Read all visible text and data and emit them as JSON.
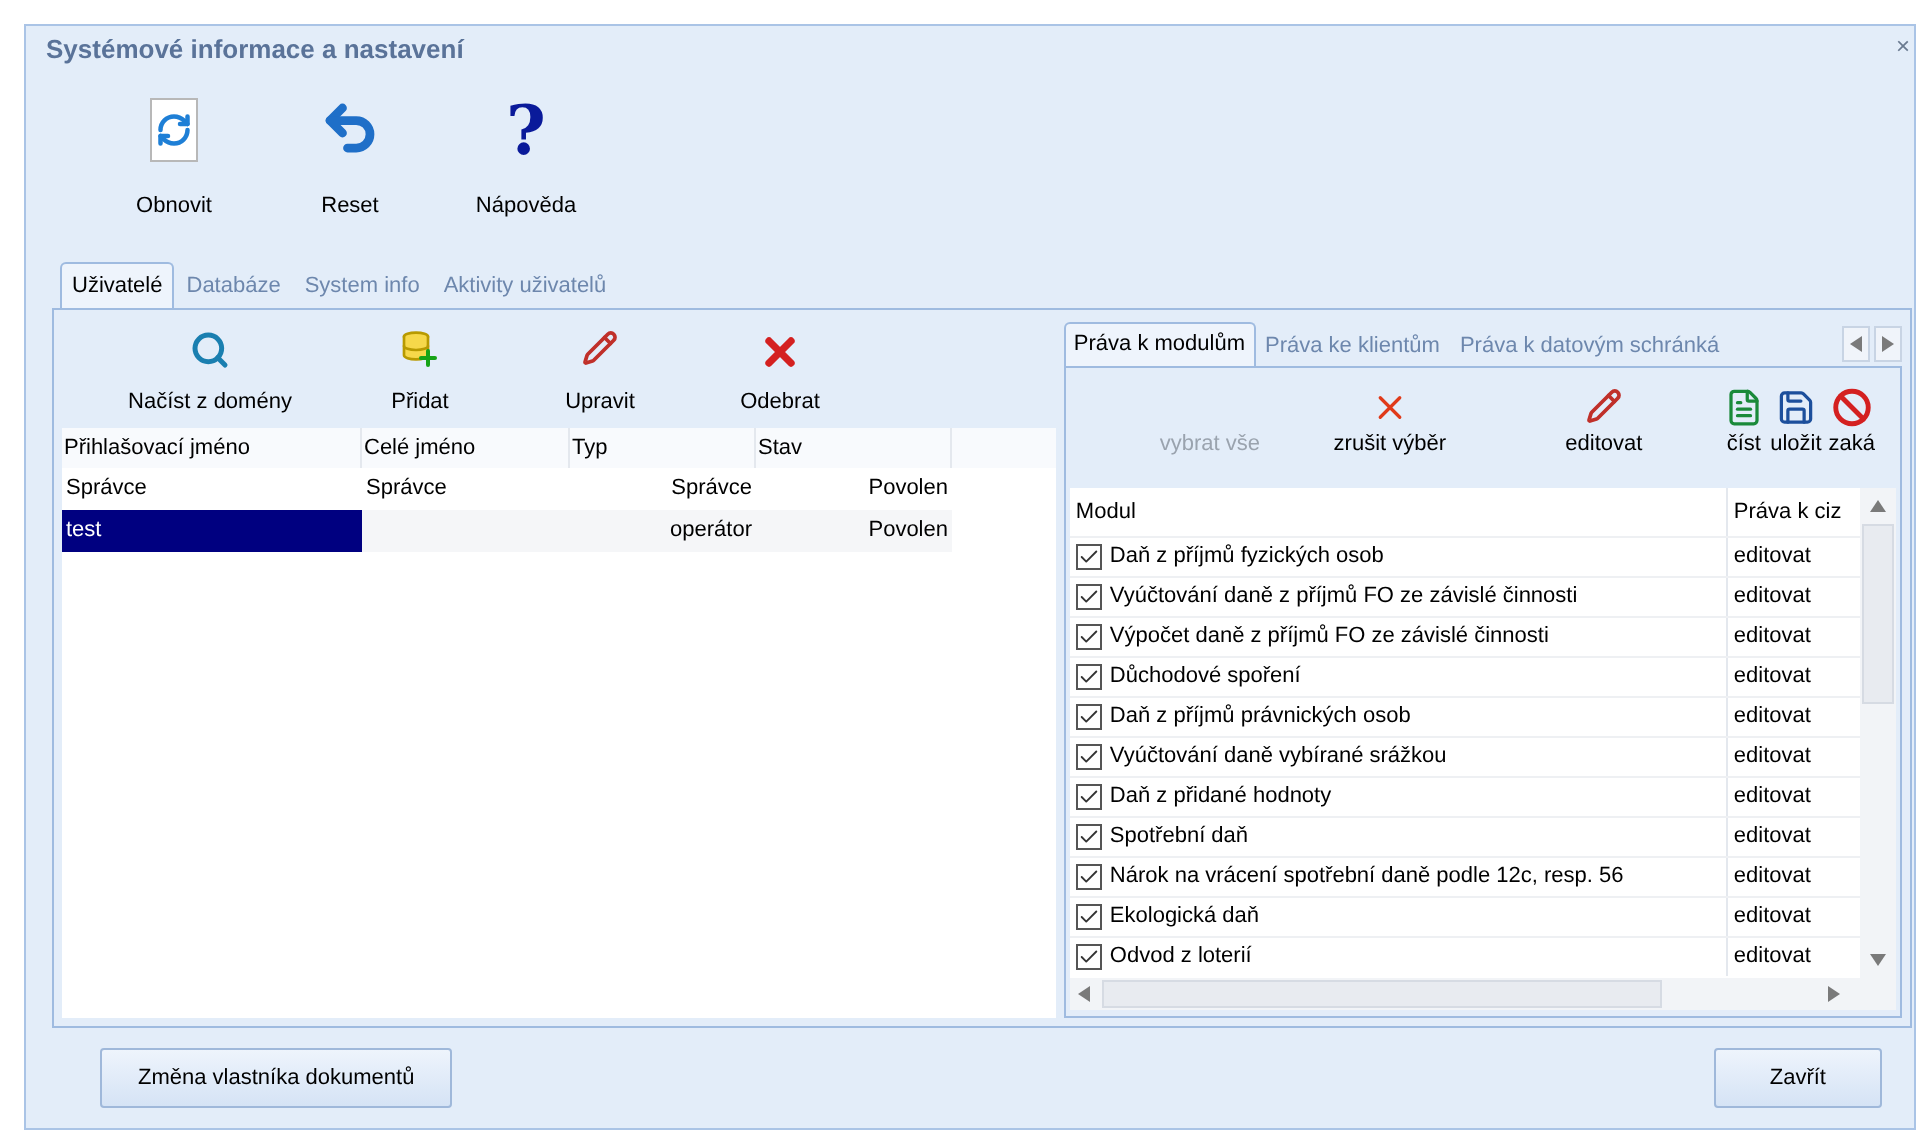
{
  "window": {
    "title": "Systémové informace a nastavení",
    "close": "×"
  },
  "toolbar": [
    {
      "kind": "refresh",
      "label": "Obnovit"
    },
    {
      "kind": "undo",
      "label": "Reset"
    },
    {
      "kind": "help",
      "glyph": "?",
      "label": "Nápověda"
    }
  ],
  "tabs": [
    {
      "label": "Uživatelé",
      "selected": true
    },
    {
      "label": "Databáze",
      "selected": false
    },
    {
      "label": "System info",
      "selected": false
    },
    {
      "label": "Aktivity uživatelů",
      "selected": false
    }
  ],
  "users_toolbar": [
    {
      "kind": "search",
      "label": "Načíst z domény"
    },
    {
      "kind": "add",
      "label": "Přidat"
    },
    {
      "kind": "edit",
      "label": "Upravit"
    },
    {
      "kind": "delete",
      "label": "Odebrat"
    }
  ],
  "users_table": {
    "columns": [
      "Přihlašovací jméno",
      "Celé jméno",
      "Typ",
      "Stav"
    ],
    "rows": [
      {
        "cells": [
          "Správce",
          "Správce",
          "Správce",
          "Povolen"
        ],
        "selected": false
      },
      {
        "cells": [
          "test",
          "",
          "operátor",
          "Povolen"
        ],
        "selected": true
      }
    ]
  },
  "rights_tabs": [
    {
      "label": "Práva k modulům",
      "selected": true
    },
    {
      "label": "Práva ke klientům",
      "selected": false
    },
    {
      "label": "Práva k datovým schránká",
      "selected": false
    }
  ],
  "rights_toolbar": [
    {
      "kind": "none",
      "label": "vybrat vše",
      "disabled": true
    },
    {
      "kind": "clear",
      "label": "zrušit výběr",
      "disabled": false
    },
    {
      "kind": "edit",
      "label": "editovat",
      "disabled": false
    },
    {
      "kind": "read",
      "label": "číst",
      "disabled": false
    },
    {
      "kind": "save",
      "label": "uložit",
      "disabled": false
    },
    {
      "kind": "forbid",
      "label": "zaká",
      "disabled": false
    }
  ],
  "modules_table": {
    "columns": [
      "Modul",
      "Práva k ciz"
    ],
    "rows": [
      {
        "name": "Daň z příjmů fyzických osob",
        "checked": true,
        "rights": "editovat"
      },
      {
        "name": "Vyúčtování daně z příjmů FO ze závislé činnosti",
        "checked": true,
        "rights": "editovat"
      },
      {
        "name": "Výpočet daně z příjmů FO ze závislé činnosti",
        "checked": true,
        "rights": "editovat"
      },
      {
        "name": "Důchodové spoření",
        "checked": true,
        "rights": "editovat"
      },
      {
        "name": "Daň z příjmů právnických osob",
        "checked": true,
        "rights": "editovat"
      },
      {
        "name": "Vyúčtování daně vybírané srážkou",
        "checked": true,
        "rights": "editovat"
      },
      {
        "name": "Daň z přidané hodnoty",
        "checked": true,
        "rights": "editovat"
      },
      {
        "name": "Spotřební daň",
        "checked": true,
        "rights": "editovat"
      },
      {
        "name": "Nárok na vrácení spotřební daně podle 12c, resp. 56",
        "checked": true,
        "rights": "editovat"
      },
      {
        "name": "Ekologická daň",
        "checked": true,
        "rights": "editovat"
      },
      {
        "name": "Odvod z loterií",
        "checked": true,
        "rights": "editovat"
      }
    ]
  },
  "footer_buttons": [
    "Změna vlastníka dokumentů",
    "Zavřít"
  ]
}
